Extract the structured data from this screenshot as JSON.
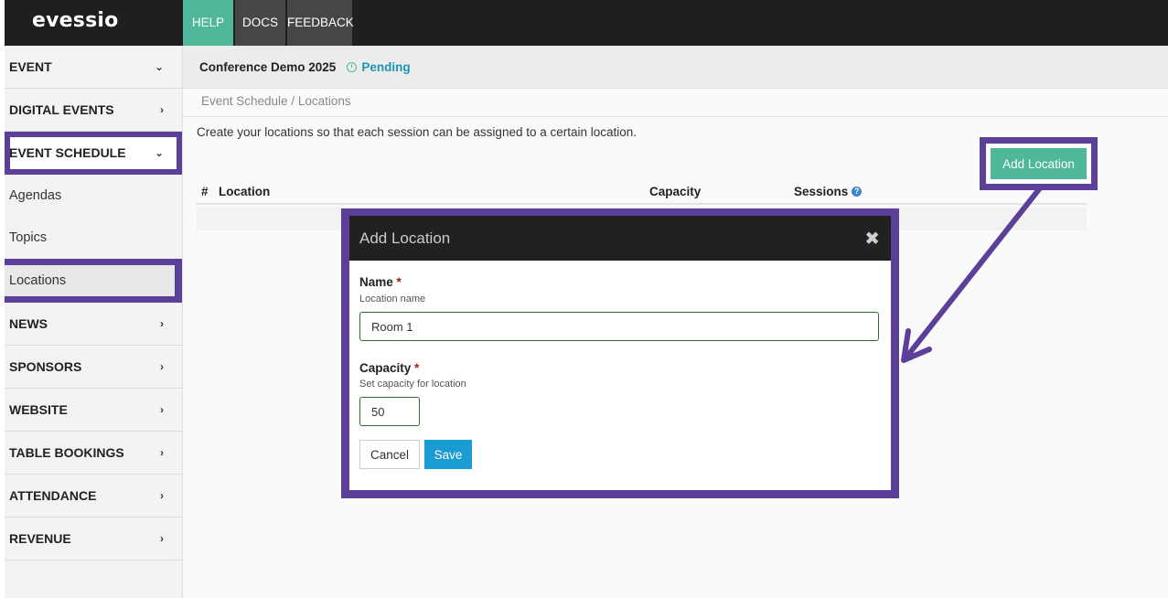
{
  "app": {
    "logo": "evessio"
  },
  "topnav": {
    "help": "HELP",
    "docs": "DOCS",
    "feedback": "FEEDBACK"
  },
  "sidebar": {
    "items": [
      {
        "label": "EVENT",
        "chevron": "⌄"
      },
      {
        "label": "DIGITAL EVENTS",
        "chevron": "›"
      },
      {
        "label": "EVENT SCHEDULE",
        "chevron": "⌄"
      },
      {
        "label": "NEWS",
        "chevron": "›"
      },
      {
        "label": "SPONSORS",
        "chevron": "›"
      },
      {
        "label": "WEBSITE",
        "chevron": "›"
      },
      {
        "label": "TABLE BOOKINGS",
        "chevron": "›"
      },
      {
        "label": "ATTENDANCE",
        "chevron": "›"
      },
      {
        "label": "REVENUE",
        "chevron": "›"
      }
    ],
    "sub_items": [
      "Agendas",
      "Topics",
      "Locations"
    ]
  },
  "header": {
    "event_name": "Conference Demo 2025",
    "status": "Pending"
  },
  "main": {
    "breadcrumb": "Event Schedule / Locations",
    "intro": "Create your locations so that each session can be assigned to a certain location.",
    "add_button": "Add Location",
    "table": {
      "columns": [
        "#",
        "Location",
        "Capacity",
        "Sessions"
      ]
    }
  },
  "modal": {
    "title": "Add Location",
    "close": "✖",
    "name_label": "Name",
    "required_mark": "*",
    "name_help": "Location name",
    "name_value": "Room 1",
    "capacity_label": "Capacity",
    "capacity_help": "Set capacity for location",
    "capacity_value": "50",
    "cancel": "Cancel",
    "save": "Save"
  },
  "colors": {
    "accent": "#4fb89a",
    "highlight": "#5c3f98",
    "primary": "#1a9bd2",
    "dark": "#1f1f1f"
  }
}
